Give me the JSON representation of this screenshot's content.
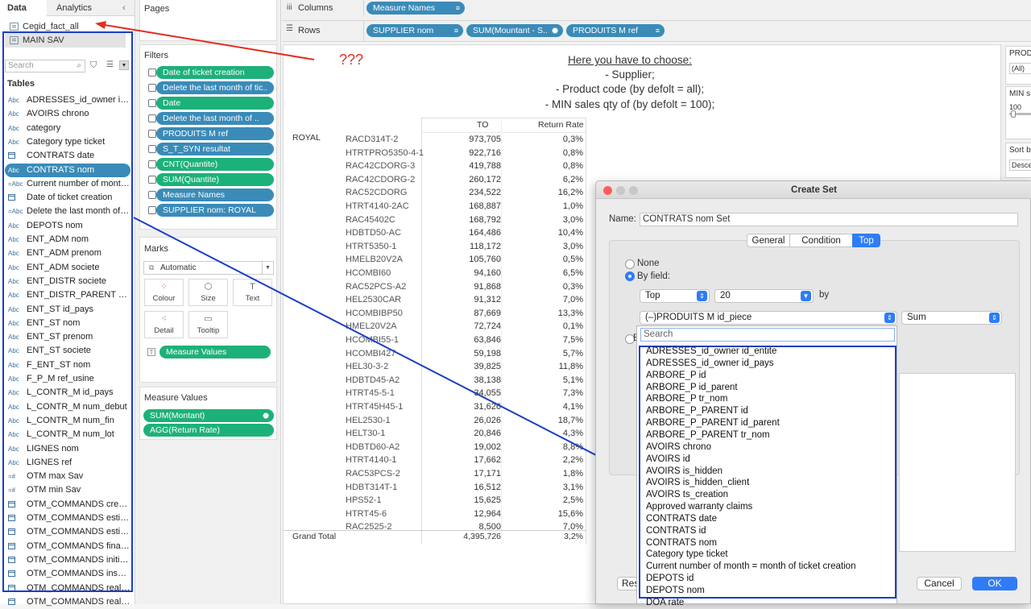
{
  "left_pane": {
    "tabs": [
      "Data",
      "Analytics"
    ],
    "datasources": [
      "Cegid_fact_all",
      "MAIN SAV"
    ],
    "search_placeholder": "Search",
    "tables_heading": "Tables",
    "fields": [
      {
        "type": "Abc",
        "label": "ADRESSES_id_owner id_p..."
      },
      {
        "type": "Abc",
        "label": "AVOIRS chrono"
      },
      {
        "type": "Abc",
        "label": "category"
      },
      {
        "type": "Abc",
        "label": "Category type  ticket"
      },
      {
        "type": "date",
        "label": "CONTRATS date"
      },
      {
        "type": "Abc",
        "label": "CONTRATS nom"
      },
      {
        "type": "=Abc",
        "label": "Current number of month ..."
      },
      {
        "type": "date",
        "label": "Date of ticket creation"
      },
      {
        "type": "=Abc",
        "label": "Delete the last month of ti..."
      },
      {
        "type": "Abc",
        "label": "DEPOTS nom"
      },
      {
        "type": "Abc",
        "label": "ENT_ADM nom"
      },
      {
        "type": "Abc",
        "label": "ENT_ADM prenom"
      },
      {
        "type": "Abc",
        "label": "ENT_ADM societe"
      },
      {
        "type": "Abc",
        "label": "ENT_DISTR societe"
      },
      {
        "type": "Abc",
        "label": "ENT_DISTR_PARENT soci..."
      },
      {
        "type": "Abc",
        "label": "ENT_ST id_pays"
      },
      {
        "type": "Abc",
        "label": "ENT_ST nom"
      },
      {
        "type": "Abc",
        "label": "ENT_ST prenom"
      },
      {
        "type": "Abc",
        "label": "ENT_ST societe"
      },
      {
        "type": "Abc",
        "label": "F_ENT_ST nom"
      },
      {
        "type": "Abc",
        "label": "F_P_M ref_usine"
      },
      {
        "type": "Abc",
        "label": "L_CONTR_M id_pays"
      },
      {
        "type": "Abc",
        "label": "L_CONTR_M num_debut"
      },
      {
        "type": "Abc",
        "label": "L_CONTR_M num_fin"
      },
      {
        "type": "Abc",
        "label": "L_CONTR_M num_lot"
      },
      {
        "type": "Abc",
        "label": "LIGNES nom"
      },
      {
        "type": "Abc",
        "label": "LIGNES ref"
      },
      {
        "type": "=#",
        "label": "OTM max Sav"
      },
      {
        "type": "=#",
        "label": "OTM min Sav"
      },
      {
        "type": "date",
        "label": "OTM_COMMANDS creatio..."
      },
      {
        "type": "date",
        "label": "OTM_COMMANDS estima..."
      },
      {
        "type": "date",
        "label": "OTM_COMMANDS estima..."
      },
      {
        "type": "date",
        "label": "OTM_COMMANDS finalD..."
      },
      {
        "type": "date",
        "label": "OTM_COMMANDS initialD..."
      },
      {
        "type": "date",
        "label": "OTM_COMMANDS inspec..."
      },
      {
        "type": "date",
        "label": "OTM_COMMANDS realArr..."
      },
      {
        "type": "date",
        "label": "OTM_COMMANDS realDe..."
      }
    ]
  },
  "pages": {
    "title": "Pages"
  },
  "filters": {
    "title": "Filters",
    "items": [
      {
        "label": "Date of ticket creation",
        "color": "green"
      },
      {
        "label": "Delete the last month of tic..",
        "color": "blue"
      },
      {
        "label": "Date",
        "color": "green"
      },
      {
        "label": "Delete the last month of ..",
        "color": "blue"
      },
      {
        "label": "PRODUITS M ref",
        "color": "blue"
      },
      {
        "label": "S_T_SYN resultat",
        "color": "blue"
      },
      {
        "label": "CNT(Quantite)",
        "color": "green"
      },
      {
        "label": "SUM(Quantite)",
        "color": "green"
      },
      {
        "label": "Measure Names",
        "color": "blue"
      },
      {
        "label": "SUPPLIER nom: ROYAL",
        "color": "blue"
      }
    ]
  },
  "marks": {
    "title": "Marks",
    "type": "Automatic",
    "buttons": [
      "Colour",
      "Size",
      "Text",
      "Detail",
      "Tooltip"
    ],
    "measure_values_pill": "Measure Values"
  },
  "measure_values": {
    "title": "Measure Values",
    "items": [
      "SUM(Montant)",
      "AGG(Return Rate)"
    ]
  },
  "shelves": {
    "columns_label": "Columns",
    "rows_label": "Rows",
    "columns": [
      "Measure Names"
    ],
    "rows": [
      "SUPPLIER nom",
      "SUM(Mountant - S..",
      "PRODUITS M ref"
    ]
  },
  "note": {
    "heading": "Here you have to choose:",
    "lines": [
      "- Supplier;",
      "- Product code (by defolt = all);",
      "- MIN sales qty of (by defolt = 100);"
    ]
  },
  "annotation": "???",
  "table": {
    "headers": [
      "TO",
      "Return Rate"
    ],
    "supplier": "ROYAL",
    "rows": [
      [
        "RACD314T-2",
        "973,705",
        "0,3%"
      ],
      [
        "HTRTPRO5350-4-1",
        "922,716",
        "0,8%"
      ],
      [
        "RAC42CDORG-3",
        "419,788",
        "0,8%"
      ],
      [
        "RAC42CDORG-2",
        "260,172",
        "6,2%"
      ],
      [
        "RAC52CDORG",
        "234,522",
        "16,2%"
      ],
      [
        "HTRT4140-2AC",
        "168,887",
        "1,0%"
      ],
      [
        "RAC45402C",
        "168,792",
        "3,0%"
      ],
      [
        "HDBTD50-AC",
        "164,486",
        "10,4%"
      ],
      [
        "HTRT5350-1",
        "118,172",
        "3,0%"
      ],
      [
        "HMELB20V2A",
        "105,760",
        "0,5%"
      ],
      [
        "HCOMBI60",
        "94,160",
        "6,5%"
      ],
      [
        "RAC52PCS-A2",
        "91,868",
        "0,3%"
      ],
      [
        "HEL2530CAR",
        "91,312",
        "7,0%"
      ],
      [
        "HCOMBIBP50",
        "87,669",
        "13,3%"
      ],
      [
        "HMEL20V2A",
        "72,724",
        "0,1%"
      ],
      [
        "HCOMBI55-1",
        "63,846",
        "7,5%"
      ],
      [
        "HCOMBI427",
        "59,198",
        "5,7%"
      ],
      [
        "HEL30-3-2",
        "39,825",
        "11,8%"
      ],
      [
        "HDBTD45-A2",
        "38,138",
        "5,1%"
      ],
      [
        "HTRT45-5-1",
        "34,055",
        "7,3%"
      ],
      [
        "HTRT45H45-1",
        "31,626",
        "4,1%"
      ],
      [
        "HEL2530-1",
        "26,026",
        "18,7%"
      ],
      [
        "HELT30-1",
        "20,846",
        "4,3%"
      ],
      [
        "HDBTD60-A2",
        "19,002",
        "8,8%"
      ],
      [
        "HTRT4140-1",
        "17,662",
        "2,2%"
      ],
      [
        "RAC53PCS-2",
        "17,171",
        "1,8%"
      ],
      [
        "HDBT314T-1",
        "16,512",
        "3,1%"
      ],
      [
        "HPS52-1",
        "15,625",
        "2,5%"
      ],
      [
        "HTRT45-6",
        "12,964",
        "15,6%"
      ],
      [
        "RAC2525-2",
        "8,500",
        "7,0%"
      ]
    ],
    "grand_total_label": "Grand Total",
    "grand_total": [
      "4,395,726",
      "3,2%"
    ]
  },
  "right_pane": {
    "cards": [
      {
        "title": "PROD",
        "value": "(All)"
      },
      {
        "title": "MIN s",
        "value": "100"
      },
      {
        "title": "Sort b",
        "value": "Desce"
      }
    ]
  },
  "dialog": {
    "title": "Create Set",
    "name_label": "Name:",
    "name_value": "CONTRATS nom Set",
    "tabs": [
      "General",
      "Condition",
      "Top"
    ],
    "active_tab": "Top",
    "radio_none": "None",
    "radio_by_field": "By field:",
    "top_select": "Top",
    "top_count": "20",
    "by_label": "by",
    "field_select": "(–)PRODUITS M id_piece",
    "agg_select": "Sum",
    "search_placeholder": "Search",
    "radio_partial": "B",
    "reset_button": "Rese",
    "cancel_button": "Cancel",
    "ok_button": "OK",
    "dropdown_items": [
      "ADRESSES_id_owner id_entite",
      "ADRESSES_id_owner id_pays",
      "ARBORE_P id",
      "ARBORE_P id_parent",
      "ARBORE_P tr_nom",
      "ARBORE_P_PARENT id",
      "ARBORE_P_PARENT id_parent",
      "ARBORE_P_PARENT tr_nom",
      "AVOIRS chrono",
      "AVOIRS id",
      "AVOIRS is_hidden",
      "AVOIRS is_hidden_client",
      "AVOIRS ts_creation",
      "Approved warranty claims",
      "CONTRATS date",
      "CONTRATS id",
      "CONTRATS nom",
      "Category type  ticket",
      "Current number of month = month of ticket creation",
      "DEPOTS id",
      "DEPOTS nom",
      "DOA rate"
    ]
  },
  "colors": {
    "green_pill": "#1db17a",
    "blue_pill": "#3a8bb8",
    "annotation_red": "#e0301e",
    "annotation_blue": "#1a3fc4",
    "dialog_accent": "#2f7cf6"
  }
}
